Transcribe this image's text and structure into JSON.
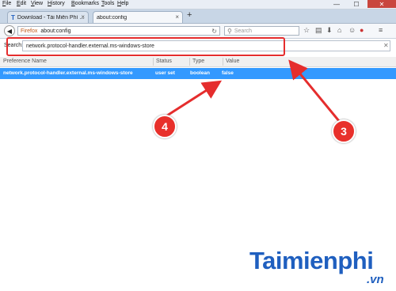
{
  "menubar": {
    "items": [
      "File",
      "Edit",
      "View",
      "History",
      "Bookmarks",
      "Tools",
      "Help"
    ],
    "window_buttons": {
      "minimize": "—",
      "maximize": "☐",
      "close": "✕"
    }
  },
  "tabs": [
    {
      "label": "Download - Tải Miễn Phí ..."
    },
    {
      "label": "about:config"
    }
  ],
  "new_tab_label": "+",
  "navbar": {
    "url_identity": "Firefox",
    "url": "about:config",
    "search_placeholder": "Search"
  },
  "config": {
    "search_label": "Search:",
    "search_value": "network.protocol-handler.external.ms-windows-store"
  },
  "table": {
    "headers": [
      "Preference Name",
      "Status",
      "Type",
      "Value"
    ],
    "rows": [
      {
        "name": "network.protocol-handler.external.ms-windows-store",
        "status": "user set",
        "type": "boolean",
        "value": "false"
      }
    ]
  },
  "callouts": {
    "a": "4",
    "b": "3"
  },
  "watermark": {
    "main": "Taimienphi",
    "suffix": ".vn"
  },
  "colors": {
    "accent_red": "#e52d2d",
    "selection_blue": "#3399ff",
    "watermark_blue": "#1f5fbf"
  }
}
